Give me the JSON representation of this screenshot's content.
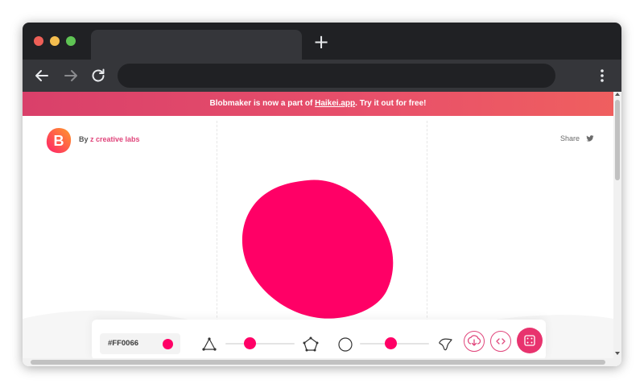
{
  "browser": {
    "controls": [
      "close",
      "minimize",
      "maximize"
    ],
    "new_tab_icon": "plus-icon",
    "nav_icons": [
      "back-arrow-icon",
      "forward-arrow-icon",
      "reload-icon"
    ],
    "menu_icon": "vertical-dots-icon"
  },
  "banner": {
    "text_before": "Blobmaker is now a part of ",
    "link": "Haikei.app",
    "text_after": ". Try it out for free!"
  },
  "header": {
    "logo_letter": "B",
    "by_label": "By ",
    "brand_name": "z creative labs",
    "share_label": "Share",
    "share_icon": "twitter-icon"
  },
  "controls": {
    "color_value": "#FF0066",
    "complexity_slider": {
      "min_icon": "triangle-icon",
      "max_icon": "pentagon-icon",
      "value": 0.35
    },
    "contrast_slider": {
      "min_icon": "circle-icon",
      "max_icon": "blob-shape-icon",
      "value": 0.45
    },
    "download_icon": "download-icon",
    "code_icon": "code-icon",
    "random_icon": "dice-icon"
  },
  "colors": {
    "blob": "#FF0066",
    "accent": "#E0457B",
    "banner_gradient": [
      "#D9406A",
      "#EF5F5F"
    ]
  }
}
